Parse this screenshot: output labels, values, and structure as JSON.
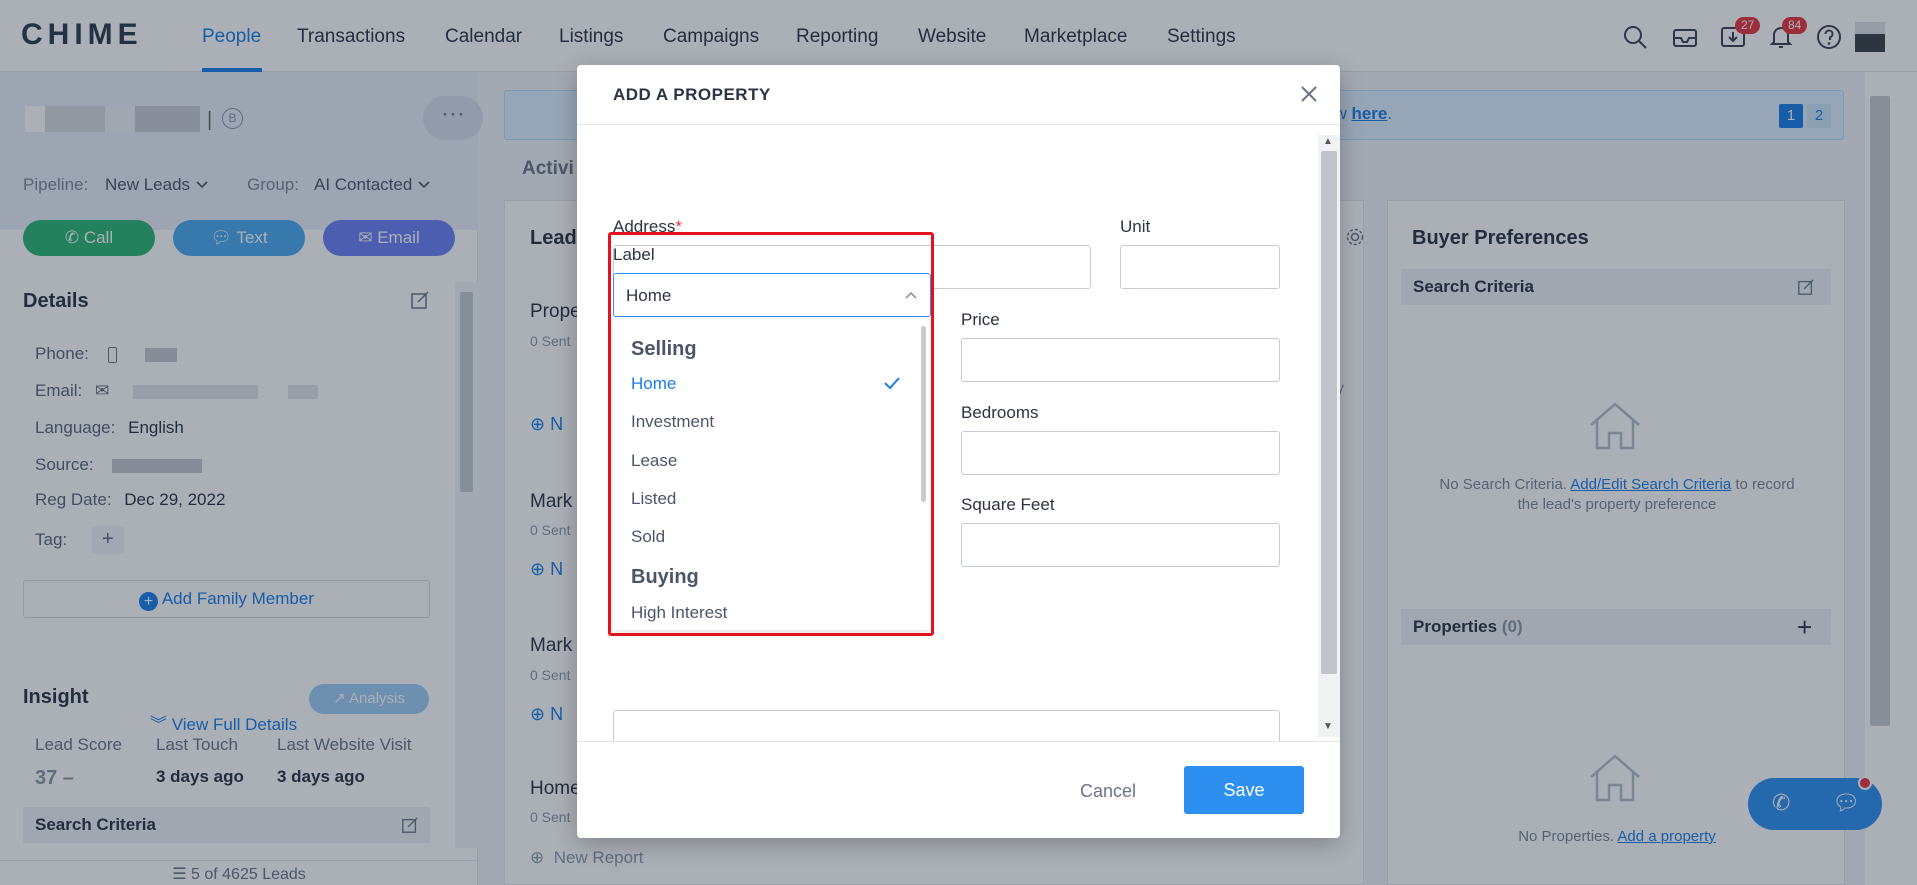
{
  "app": {
    "logo": "CHIME"
  },
  "nav": {
    "items": [
      "People",
      "Transactions",
      "Calendar",
      "Listings",
      "Campaigns",
      "Reporting",
      "Website",
      "Marketplace",
      "Settings"
    ],
    "active": "People",
    "badges": {
      "download": "27",
      "notifications": "84"
    }
  },
  "lead": {
    "badge_letter": "B",
    "more": "···",
    "pipeline_label": "Pipeline:",
    "pipeline_value": "New Leads",
    "group_label": "Group:",
    "group_value": "AI Contacted",
    "actions": {
      "call": "Call",
      "text": "Text",
      "email": "Email"
    },
    "details_title": "Details",
    "details": {
      "phone_label": "Phone:",
      "email_label": "Email:",
      "language_label": "Language:",
      "language_value": "English",
      "source_label": "Source:",
      "reg_date_label": "Reg Date:",
      "reg_date_value": "Dec 29, 2022",
      "tag_label": "Tag:"
    },
    "add_family": "Add Family Member",
    "view_full": "View Full Details",
    "insight_title": "Insight",
    "analysis": "Analysis",
    "insight": {
      "lead_score_label": "Lead Score",
      "lead_score_value": "37 –",
      "last_touch_label": "Last Touch",
      "last_touch_value": "3 days ago",
      "last_visit_label": "Last Website Visit",
      "last_visit_value": "3 days ago"
    },
    "search_criteria": "Search Criteria",
    "footer": "5 of 4625 Leads"
  },
  "center": {
    "banner_tail": "ew",
    "banner_link": "here",
    "pages": [
      "1",
      "2"
    ],
    "tab_partial": "Activi",
    "card_partial": "Lead",
    "rows": [
      {
        "title": "Prope",
        "sent": "0 Sent"
      },
      {
        "title": "Mark",
        "sent": "0 Sent"
      },
      {
        "title": "Mark",
        "sent": "0 Sent"
      },
      {
        "title": "Home",
        "sent": "0 Sent"
      }
    ],
    "add_partial": "N",
    "daily_partial": "aily",
    "new_report": "New Report"
  },
  "buyer": {
    "title": "Buyer Preferences",
    "search_criteria": "Search Criteria",
    "sc_empty_pre": "No Search Criteria.",
    "sc_empty_link": "Add/Edit Search Criteria",
    "sc_empty_post": "to record",
    "sc_empty_line2": "the lead's property preference",
    "properties_label": "Properties",
    "properties_count": "(0)",
    "no_props_pre": "No Properties.",
    "no_props_link": "Add a property"
  },
  "modal": {
    "title": "ADD A PROPERTY",
    "address_label": "Address",
    "required_mark": "*",
    "unit_label": "Unit",
    "label_label": "Label",
    "label_value": "Home",
    "price_label": "Price",
    "bedrooms_label": "Bedrooms",
    "sqft_label": "Square Feet",
    "cancel": "Cancel",
    "save": "Save",
    "dropdown": {
      "groups": [
        {
          "name": "Selling",
          "options": [
            "Home",
            "Investment",
            "Lease",
            "Listed",
            "Sold"
          ]
        },
        {
          "name": "Buying",
          "options": [
            "High Interest"
          ]
        }
      ],
      "selected": "Home"
    }
  },
  "colors": {
    "accent": "#1a7ee6",
    "call": "#2bb673",
    "text": "#4aa8f0",
    "email": "#6b7ff3",
    "highlight": "#e3121e"
  }
}
